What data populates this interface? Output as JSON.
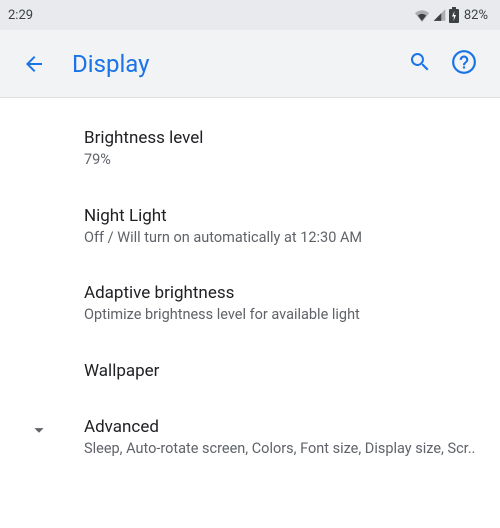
{
  "status": {
    "time": "2:29",
    "battery_pct": "82%"
  },
  "appbar": {
    "title": "Display"
  },
  "items": {
    "brightness": {
      "title": "Brightness level",
      "subtitle": "79%"
    },
    "night_light": {
      "title": "Night Light",
      "subtitle": "Off / Will turn on automatically at 12:30 AM"
    },
    "adaptive": {
      "title": "Adaptive brightness",
      "subtitle": "Optimize brightness level for available light"
    },
    "wallpaper": {
      "title": "Wallpaper"
    },
    "advanced": {
      "title": "Advanced",
      "subtitle": "Sleep, Auto-rotate screen, Colors, Font size, Display size, Scr.."
    }
  },
  "colors": {
    "accent": "#1a73e8"
  }
}
